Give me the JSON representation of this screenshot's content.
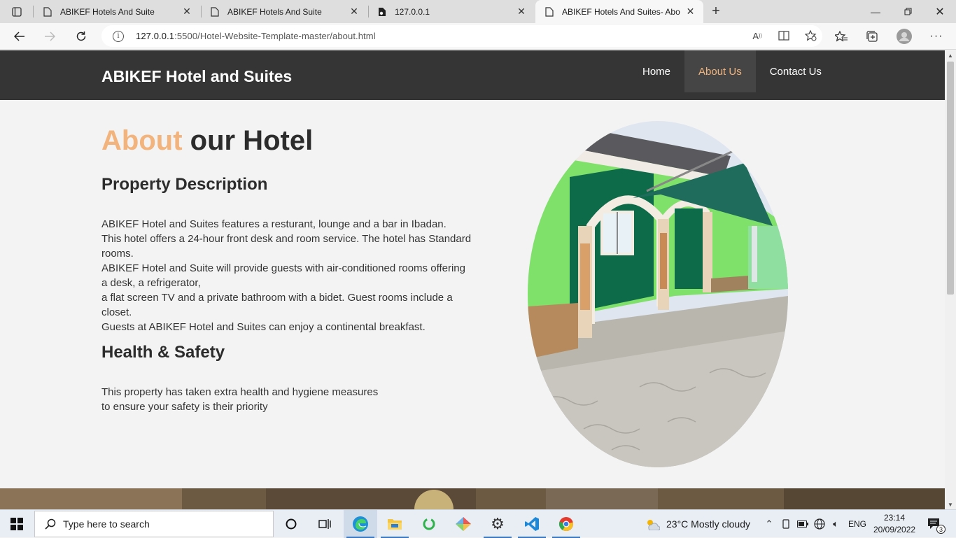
{
  "browser": {
    "tabs": [
      {
        "title": "ABIKEF Hotels And Suite",
        "active": false
      },
      {
        "title": "ABIKEF Hotels And Suite",
        "active": false
      },
      {
        "title": "127.0.0.1",
        "active": false
      },
      {
        "title": "ABIKEF Hotels And Suites- About",
        "active": true
      }
    ],
    "url_host": "127.0.0.1",
    "url_rest": ":5500/Hotel-Website-Template-master/about.html"
  },
  "site": {
    "brand": "ABIKEF Hotel and Suites",
    "nav": [
      {
        "label": "Home",
        "active": false
      },
      {
        "label": "About Us",
        "active": true
      },
      {
        "label": "Contact Us",
        "active": false
      }
    ],
    "colors": {
      "accent": "#f2b47c",
      "nav_bg": "#353535"
    }
  },
  "about": {
    "title_accent": "About",
    "title_rest": " our Hotel",
    "property_heading": "Property Description",
    "property_lines": [
      "ABIKEF Hotel and Suites features a resturant, lounge and a bar in Ibadan.",
      "This hotel offers a 24-hour front desk and room service. The hotel has Standard rooms.",
      "ABIKEF Hotel and Suite will provide guests with air-conditioned rooms offering a desk, a refrigerator,",
      "a flat screen TV and a private bathroom with a bidet. Guest rooms include a closet.",
      "Guests at ABIKEF Hotel and Suites can enjoy a continental breakfast."
    ],
    "safety_heading": "Health & Safety",
    "safety_lines": [
      "This property has taken extra health and hygiene measures",
      "to ensure your safety is their priority"
    ]
  },
  "taskbar": {
    "search_placeholder": "Type here to search",
    "weather": "23°C  Mostly cloudy",
    "language": "ENG",
    "time": "23:14",
    "date": "20/09/2022",
    "notifications": "3"
  }
}
